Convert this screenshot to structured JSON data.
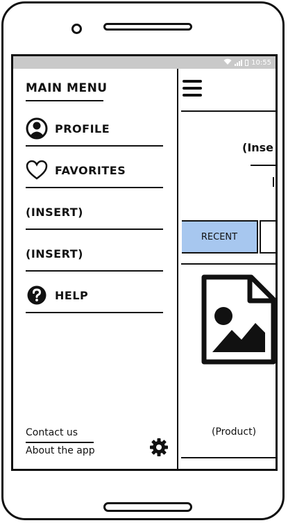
{
  "status_bar": {
    "time": "10:55"
  },
  "drawer": {
    "title": "MAIN MENU",
    "items": [
      {
        "label": "PROFILE",
        "icon": "user-circle-icon"
      },
      {
        "label": "FAVORITES",
        "icon": "heart-icon"
      },
      {
        "label": "(INSERT)",
        "icon": ""
      },
      {
        "label": "(INSERT)",
        "icon": ""
      },
      {
        "label": "HELP",
        "icon": "help-circle-icon"
      }
    ],
    "footer": {
      "contact": "Contact us",
      "about": "About the app",
      "settings_icon": "gear-icon"
    }
  },
  "main": {
    "menu_icon": "hamburger-icon",
    "insert_text": "(Inse",
    "tabs": [
      {
        "label": "RECENT",
        "selected": true
      },
      {
        "label": "",
        "selected": false
      }
    ],
    "product": {
      "label": "(Product)",
      "icon": "image-file-icon"
    }
  },
  "colors": {
    "tab_selected": "#a7c7ef",
    "status_bar": "#c9c9c9"
  }
}
